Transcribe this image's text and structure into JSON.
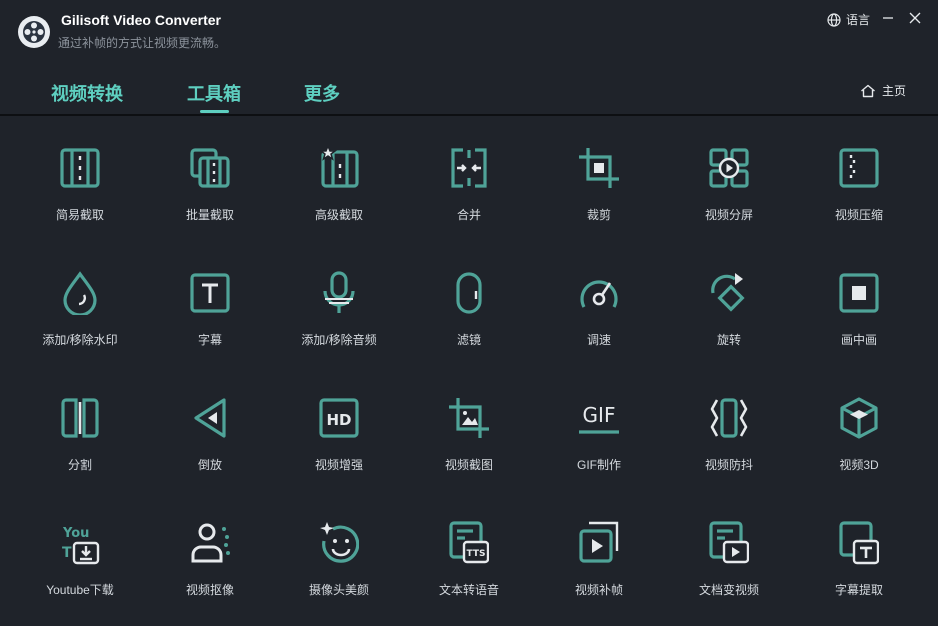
{
  "app": {
    "title": "Gilisoft Video Converter",
    "subtitle": "通过补帧的方式让视频更流畅。",
    "language_label": "语言"
  },
  "nav": {
    "tabs": [
      {
        "label": "视频转换"
      },
      {
        "label": "工具箱"
      },
      {
        "label": "更多"
      }
    ],
    "home_label": "主页"
  },
  "colors": {
    "accent": "#5ecfc0",
    "icon_stroke": "#4fa398",
    "background": "#1f232a"
  },
  "tools": [
    {
      "label": "简易截取",
      "icon": "film-strip-icon"
    },
    {
      "label": "批量截取",
      "icon": "film-stack-icon"
    },
    {
      "label": "高级截取",
      "icon": "film-star-icon"
    },
    {
      "label": "合并",
      "icon": "merge-icon"
    },
    {
      "label": "裁剪",
      "icon": "crop-icon"
    },
    {
      "label": "视频分屏",
      "icon": "split-screen-icon"
    },
    {
      "label": "视频压缩",
      "icon": "compress-icon"
    },
    {
      "label": "添加/移除水印",
      "icon": "watermark-drop-icon"
    },
    {
      "label": "字幕",
      "icon": "subtitle-t-icon"
    },
    {
      "label": "添加/移除音频",
      "icon": "microphone-icon"
    },
    {
      "label": "滤镜",
      "icon": "filter-icon"
    },
    {
      "label": "调速",
      "icon": "speed-gauge-icon"
    },
    {
      "label": "旋转",
      "icon": "rotate-icon"
    },
    {
      "label": "画中画",
      "icon": "picture-in-picture-icon"
    },
    {
      "label": "分割",
      "icon": "split-icon"
    },
    {
      "label": "倒放",
      "icon": "reverse-play-icon"
    },
    {
      "label": "视频增强",
      "icon": "hd-icon"
    },
    {
      "label": "视频截图",
      "icon": "screenshot-image-icon"
    },
    {
      "label": "GIF制作",
      "icon": "gif-icon"
    },
    {
      "label": "视频防抖",
      "icon": "stabilize-icon"
    },
    {
      "label": "视频3D",
      "icon": "cube-3d-icon"
    },
    {
      "label": "Youtube下载",
      "icon": "youtube-download-icon"
    },
    {
      "label": "视频抠像",
      "icon": "person-cutout-icon"
    },
    {
      "label": "摄像头美颜",
      "icon": "face-beauty-icon"
    },
    {
      "label": "文本转语音",
      "icon": "text-to-speech-icon"
    },
    {
      "label": "视频补帧",
      "icon": "frame-interpolation-icon"
    },
    {
      "label": "文档变视频",
      "icon": "document-to-video-icon"
    },
    {
      "label": "字幕提取",
      "icon": "subtitle-extract-icon"
    }
  ],
  "icon_text": {
    "hd": "HD",
    "gif": "GIF",
    "tts": "TTS",
    "you": "You",
    "t": "T"
  }
}
